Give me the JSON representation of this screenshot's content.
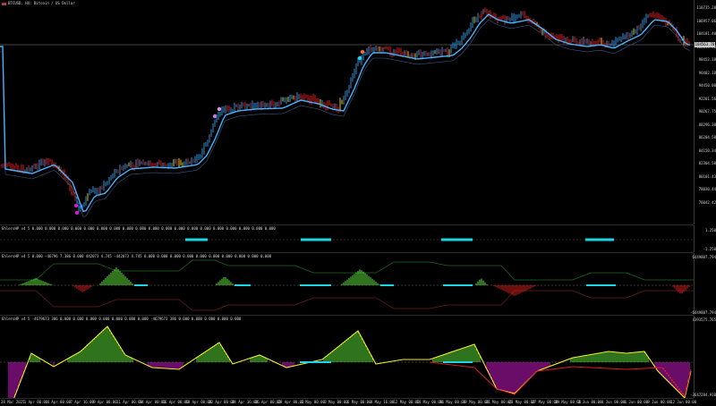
{
  "main_chart": {
    "title": "BTCUSD, H4: Bitcoin / US Dollar",
    "current_price_label": "104563.78",
    "y_labels": [
      "110735.28",
      "106957.06",
      "104181.40",
      "102034.48",
      "98452.18",
      "96402.18",
      "94450.00",
      "92201.56",
      "90267.75",
      "88296.30",
      "86204.58",
      "84150.34",
      "82304.58",
      "80101.43",
      "78030.44",
      "76042.42"
    ]
  },
  "sub1": {
    "title": "EhlersHP v4 5 0.000 0.000 0.000 0.000 0.000 0.000 0.000 0.000 0.000 0.000 0.000 0.000 0.000 0.000 0.000 0.000 0.000 0.000 0.000",
    "y_labels": [
      "1.250",
      "-1.250"
    ]
  },
  "sub2": {
    "title": "EhlersHP v4 5 0.000 -46796 7.386 0.000 442073 4.745 -442073 4.745 0.000 0.000 0.000 0.000 0.000 0.000 0.000 0.000 0.000 0.000",
    "y_labels": [
      "6449807.794",
      "-6449807.794"
    ]
  },
  "sub3": {
    "title": "EhlersHP v4 5 -4679673 386 0.000 0.000 0.000 0.000 0.000 0.000 0.000 -4679673 386 0.000 0.000 0.000 0.000 0.000",
    "y_labels": [
      "4393575.765",
      "-3647284.910"
    ]
  },
  "x_labels": [
    "28 Mar 2025",
    "1 Apr 00:00",
    "4 Apr 00:00",
    "7 Apr 16:00",
    "9 Apr 00:00",
    "11 Apr 00:00",
    "14 Apr 00:00",
    "16 Apr 00:00",
    "18 Apr 00:00",
    "22 Apr 00:00",
    "24 Apr 16:00",
    "26 Apr 00:00",
    "29 Apr 00:00",
    "1 May 00:00",
    "3 May 00:00",
    "6 May 00:00",
    "8 May 16:00",
    "12 May 00:00",
    "14 May 00:00",
    "16 May 00:00",
    "19 May 00:00",
    "21 May 00:00",
    "23 May 00:00",
    "27 May 00:00",
    "29 May 00:00",
    "2 Jun 00:00",
    "4 Jun 00:00",
    "6 Jun 00:00",
    "9 Jun 00:00",
    "12 Jun 00:00"
  ],
  "colors": {
    "bull_candle": "#2f8fd8",
    "bear_candle": "#d81e1e",
    "neutral_candle": "#e8c21a",
    "ma_line": "#46b4ff",
    "ma_line_down": "#ff2a2a",
    "hist_up": "#5ee83a",
    "hist_down": "#d81e1e",
    "cyan": "#1fd4e6",
    "magenta": "#d21ad2",
    "envelope": "#1f6a1f",
    "envelope_red": "#6a1f1f",
    "osc_line": "#f2ec2a",
    "price_line": "#8a8a8a"
  }
}
